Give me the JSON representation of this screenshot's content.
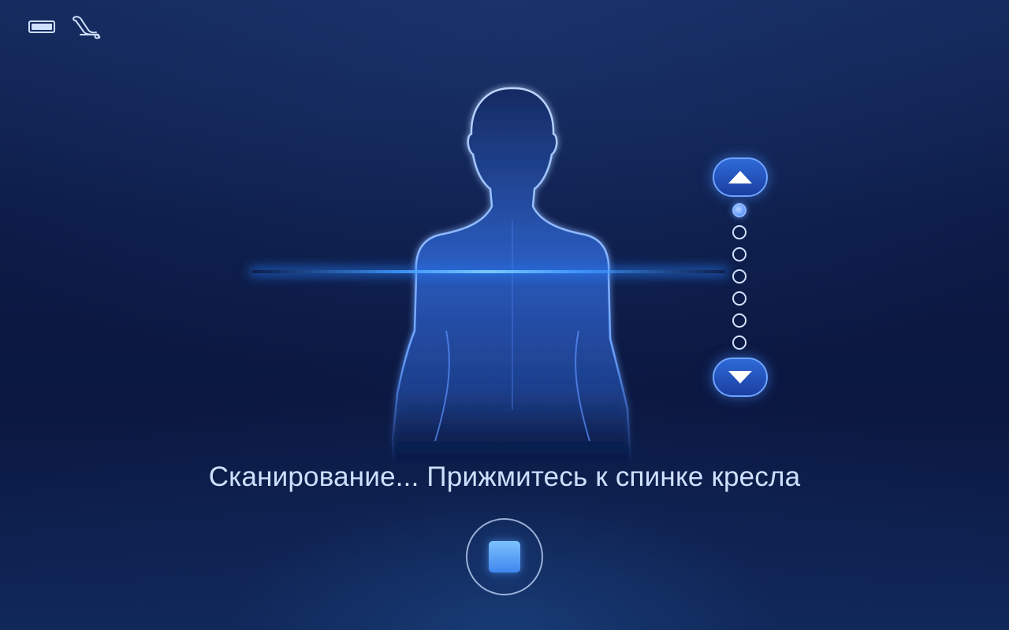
{
  "status": {
    "battery_level": 1.0,
    "icons": [
      "battery-icon",
      "massage-chair-icon"
    ]
  },
  "scan": {
    "message": "Сканирование... Прижмитесь к спинке кресла",
    "line_color": "#3a8bff"
  },
  "position_control": {
    "up_icon": "triangle-up-icon",
    "down_icon": "triangle-down-icon",
    "total_steps": 7,
    "current_step": 1
  },
  "stop_button": {
    "icon": "stop-icon",
    "color": "#5aa4ff"
  },
  "colors": {
    "background": "#0c1a45",
    "accent": "#2f6ad8",
    "text": "#cfe0ff"
  }
}
